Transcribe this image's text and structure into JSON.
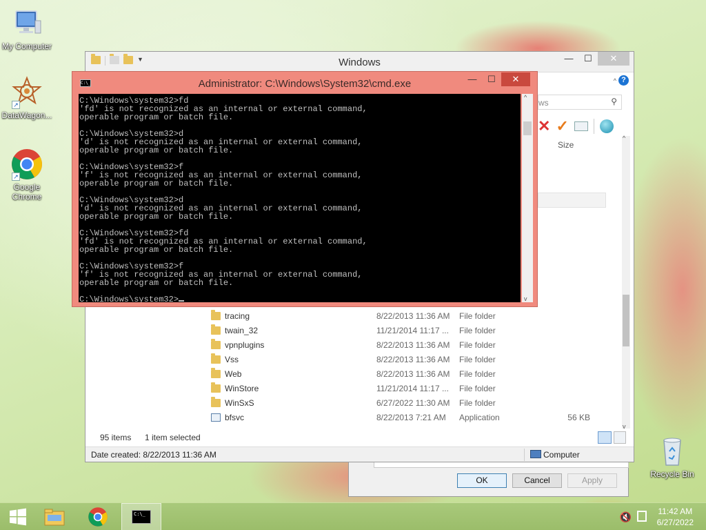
{
  "desktop": {
    "icons": [
      {
        "label": "My Computer"
      },
      {
        "label": "DataWagon..."
      },
      {
        "label": "Google Chrome"
      },
      {
        "label": "Recycle Bin"
      }
    ]
  },
  "explorer": {
    "title": "Windows",
    "search_partial": "ws",
    "size_header": "Size",
    "files": [
      {
        "name": "tracing",
        "date": "8/22/2013 11:36 AM",
        "type": "File folder",
        "size": ""
      },
      {
        "name": "twain_32",
        "date": "11/21/2014 11:17 ...",
        "type": "File folder",
        "size": ""
      },
      {
        "name": "vpnplugins",
        "date": "8/22/2013 11:36 AM",
        "type": "File folder",
        "size": ""
      },
      {
        "name": "Vss",
        "date": "8/22/2013 11:36 AM",
        "type": "File folder",
        "size": ""
      },
      {
        "name": "Web",
        "date": "8/22/2013 11:36 AM",
        "type": "File folder",
        "size": ""
      },
      {
        "name": "WinStore",
        "date": "11/21/2014 11:17 ...",
        "type": "File folder",
        "size": ""
      },
      {
        "name": "WinSxS",
        "date": "6/27/2022 11:30 AM",
        "type": "File folder",
        "size": ""
      },
      {
        "name": "bfsvc",
        "date": "8/22/2013 7:21 AM",
        "type": "Application",
        "size": "56 KB"
      }
    ],
    "item_count": "95 items",
    "selected_count": "1 item selected",
    "date_created": "Date created: 8/22/2013 11:36 AM",
    "location": "Computer"
  },
  "dialog": {
    "ok": "OK",
    "cancel": "Cancel",
    "apply": "Apply"
  },
  "cmd": {
    "title": "Administrator: C:\\Windows\\System32\\cmd.exe",
    "icon_text": "C:\\_",
    "lines": [
      "C:\\Windows\\system32>fd",
      "'fd' is not recognized as an internal or external command,",
      "operable program or batch file.",
      "",
      "C:\\Windows\\system32>d",
      "'d' is not recognized as an internal or external command,",
      "operable program or batch file.",
      "",
      "C:\\Windows\\system32>f",
      "'f' is not recognized as an internal or external command,",
      "operable program or batch file.",
      "",
      "C:\\Windows\\system32>d",
      "'d' is not recognized as an internal or external command,",
      "operable program or batch file.",
      "",
      "C:\\Windows\\system32>fd",
      "'fd' is not recognized as an internal or external command,",
      "operable program or batch file.",
      "",
      "C:\\Windows\\system32>f",
      "'f' is not recognized as an internal or external command,",
      "operable program or batch file.",
      ""
    ],
    "prompt": "C:\\Windows\\system32>"
  },
  "taskbar": {
    "time": "11:42 AM",
    "date": "6/27/2022",
    "items": [
      "start-icon",
      "file-explorer-icon",
      "chrome-icon",
      "cmd-icon"
    ]
  },
  "colors": {
    "cmd_frame": "#f08a7e",
    "cmd_close": "#c9493e",
    "taskbar": "#a9c97b",
    "folder": "#e8c25a"
  }
}
